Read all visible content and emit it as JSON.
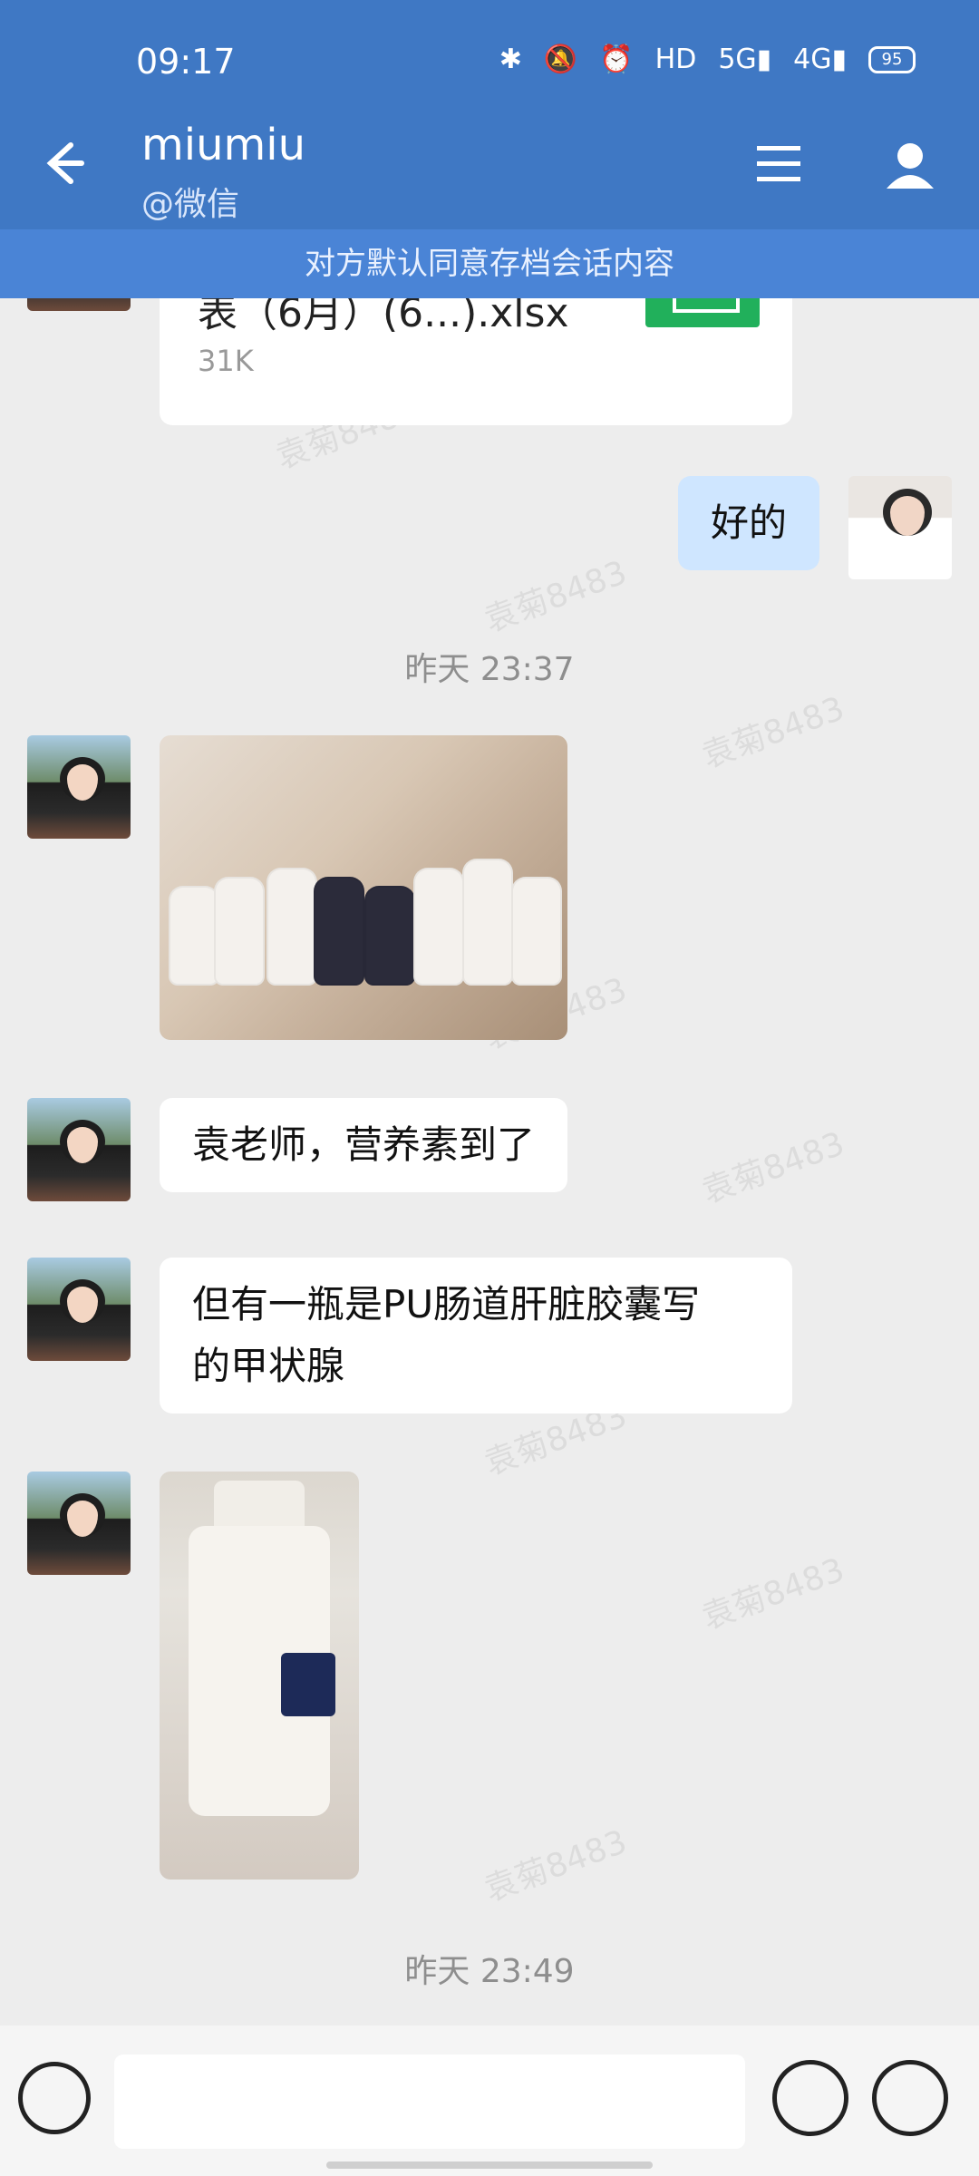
{
  "status": {
    "time": "09:17",
    "icons": [
      "bluetooth-icon",
      "mute-icon",
      "alarm-icon",
      "hd-icon",
      "5g-signal-icon",
      "4g-signal-icon"
    ],
    "battery": "95"
  },
  "header": {
    "name": "miumiu",
    "sub": "@微信"
  },
  "notice": "对方默认同意存档会话内容",
  "chat": {
    "file": {
      "name": "表（6月）(6...).xlsx",
      "size": "31K",
      "icon": "excel-icon"
    },
    "reply_me": "好的",
    "timestamp1": "昨天  23:37",
    "msg1": "袁老师，营养素到了",
    "msg2_line1": "但有一瓶是PU肠道肝脏胶囊写",
    "msg2_line2": "的甲状腺",
    "timestamp2": "昨天  23:49",
    "watermark": "袁菊8483"
  },
  "colors": {
    "header": "#3f78c4",
    "notice": "#4a84d6",
    "my_bubble": "#cfe6ff"
  }
}
